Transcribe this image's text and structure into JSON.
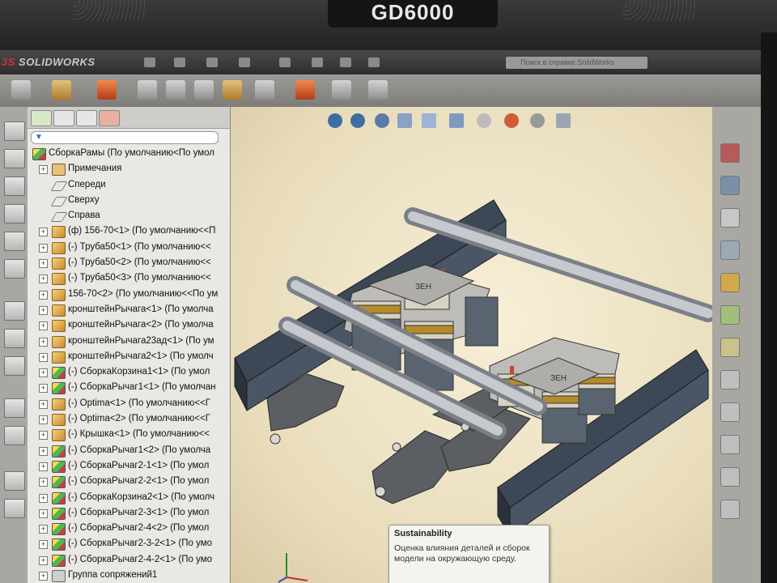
{
  "monitor": {
    "brand": "GD6000"
  },
  "app": {
    "name_red": "3S",
    "name": "SOLIDWORKS"
  },
  "search": {
    "placeholder": "Поиск в справке SolidWorks"
  },
  "feature_tree": {
    "root": "СборкаРамы  (По умолчанию<По умол",
    "items": [
      {
        "type": "note",
        "exp": "+",
        "label": "Примечания"
      },
      {
        "type": "plane",
        "exp": "",
        "label": "Спереди"
      },
      {
        "type": "plane",
        "exp": "",
        "label": "Сверху"
      },
      {
        "type": "plane",
        "exp": "",
        "label": "Справа"
      },
      {
        "type": "part",
        "exp": "+",
        "label": "(ф) 156-70<1> (По умолчанию<<П"
      },
      {
        "type": "part",
        "exp": "+",
        "label": "(-) Труба50<1> (По умолчанию<<"
      },
      {
        "type": "part",
        "exp": "+",
        "label": "(-) Труба50<2> (По умолчанию<<"
      },
      {
        "type": "part",
        "exp": "+",
        "label": "(-) Труба50<3> (По умолчанию<<"
      },
      {
        "type": "part",
        "exp": "+",
        "label": "156-70<2> (По умолчанию<<По ум"
      },
      {
        "type": "part",
        "exp": "+",
        "label": "кронштейнРычага<1> (По умолча"
      },
      {
        "type": "part",
        "exp": "+",
        "label": "кронштейнРычага<2> (По умолча"
      },
      {
        "type": "part",
        "exp": "+",
        "label": "кронштейнРычага23ад<1> (По ум"
      },
      {
        "type": "part",
        "exp": "+",
        "label": "кронштейнРычага2<1> (По умолч"
      },
      {
        "type": "asm",
        "exp": "+",
        "label": "(-) СборкаКорзина1<1> (По умол"
      },
      {
        "type": "asm",
        "exp": "+",
        "label": "(-) СборкаРычаг1<1> (По умолчан"
      },
      {
        "type": "part",
        "exp": "+",
        "label": "(-) Optima<1> (По умолчанию<<Г"
      },
      {
        "type": "part",
        "exp": "+",
        "label": "(-) Optima<2> (По умолчанию<<Г"
      },
      {
        "type": "part",
        "exp": "+",
        "label": "(-) Крышка<1> (По умолчанию<<"
      },
      {
        "type": "asm",
        "exp": "+",
        "label": "(-) СборкаРычаг1<2> (По умолча"
      },
      {
        "type": "asm",
        "exp": "+",
        "label": "(-) СборкаРычаг2-1<1> (По умол"
      },
      {
        "type": "asm",
        "exp": "+",
        "label": "(-) СборкаРычаг2-2<1> (По умол"
      },
      {
        "type": "asm",
        "exp": "+",
        "label": "(-) СборкаКорзина2<1> (По умолч"
      },
      {
        "type": "asm",
        "exp": "+",
        "label": "(-) СборкаРычаг2-3<1> (По умол"
      },
      {
        "type": "asm",
        "exp": "+",
        "label": "(-) СборкаРычаг2-4<2> (По умол"
      },
      {
        "type": "asm",
        "exp": "+",
        "label": "(-) СборкаРычаг2-3-2<1> (По умо"
      },
      {
        "type": "asm",
        "exp": "+",
        "label": "(-) СборкаРычаг2-4-2<1> (По умо"
      },
      {
        "type": "mate",
        "exp": "+",
        "label": "Группа сопряжений1"
      }
    ]
  },
  "tooltip": {
    "title": "Sustainability",
    "body": "Оценка влияния деталей и сборок модели на окружающую среду."
  },
  "model": {
    "plate_text": "ЗЕН"
  }
}
